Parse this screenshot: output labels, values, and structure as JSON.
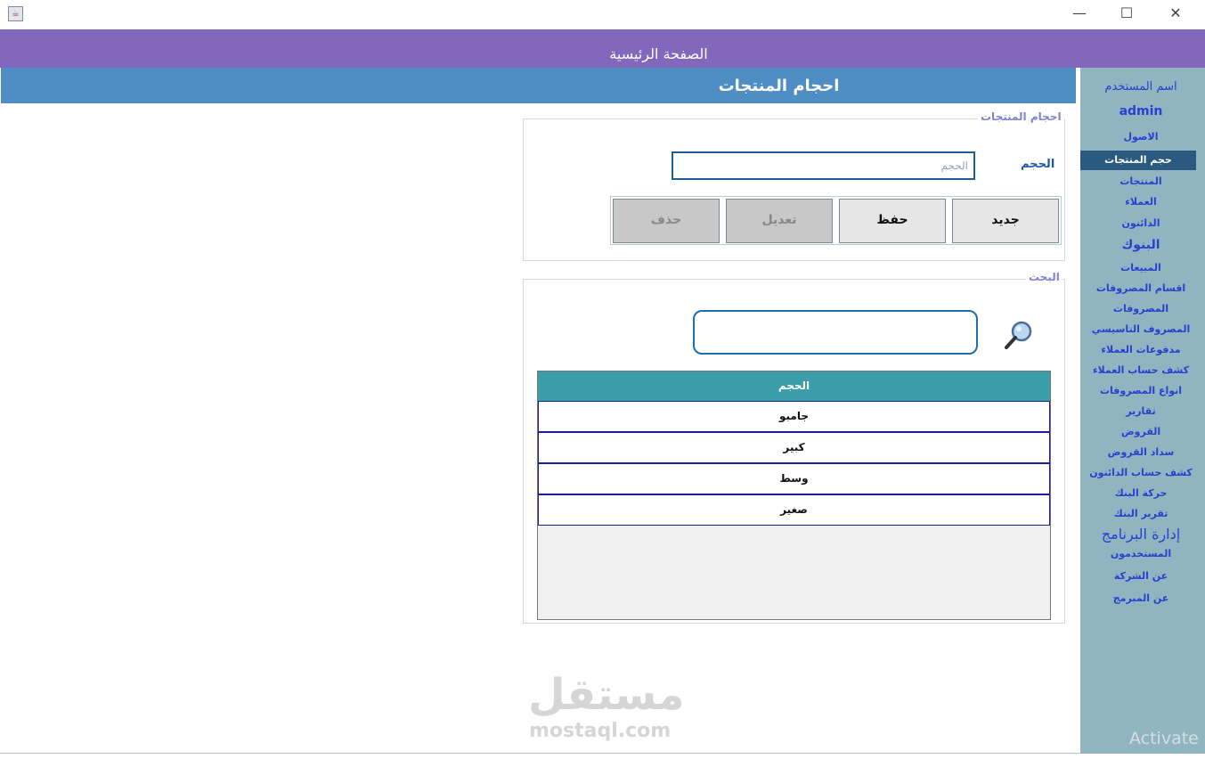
{
  "window": {
    "minimize": "—",
    "maximize": "☐",
    "close": "✕",
    "icon": "java-cup-icon"
  },
  "topbar": {
    "title": "الصفحة الرئيسية"
  },
  "header": {
    "title": "احجام المنتجات"
  },
  "sidebar": {
    "user_label": "اسم المستخدم",
    "username": "admin",
    "items": [
      {
        "label": "الاصول"
      },
      {
        "label": "حجم المنتجات",
        "active": true
      },
      {
        "label": "المنتجات"
      },
      {
        "label": "العملاء"
      },
      {
        "label": "الدائنون"
      },
      {
        "label": "البنوك"
      },
      {
        "label": "المبيعات"
      },
      {
        "label": "اقسام المصروفات"
      },
      {
        "label": "المصروفات"
      },
      {
        "label": "المصروف التاسيسي"
      },
      {
        "label": "مدفوعات العملاء"
      },
      {
        "label": "كشف حساب العملاء"
      },
      {
        "label": "انواع المصروفات"
      },
      {
        "label": "تقارير"
      },
      {
        "label": "القروض"
      },
      {
        "label": "سداد القروض"
      },
      {
        "label": "كشف حساب الدائنون"
      },
      {
        "label": "حركة البنك"
      },
      {
        "label": "تقرير البنك"
      },
      {
        "label": "إدارة البرنامج"
      },
      {
        "label": "المستخدمون"
      },
      {
        "label": "عن الشركة"
      },
      {
        "label": "عن المبرمج"
      }
    ]
  },
  "form": {
    "legend": "احجام المنتجات",
    "volume_label": "الحجم",
    "volume_placeholder": "الحجم",
    "buttons": {
      "new": "جديد",
      "save": "حفظ",
      "edit": "تعديل",
      "delete": "حذف"
    }
  },
  "search": {
    "legend": "البحث",
    "table": {
      "header": "الحجم",
      "rows": [
        "جامبو",
        "كبير",
        "وسط",
        "صغير"
      ]
    }
  },
  "watermark": {
    "arabic": "مستقل",
    "latin": "mostaql.com"
  },
  "activate_text": "Activate",
  "colors": {
    "topbar": "#8268bd",
    "header": "#4f8ec4",
    "sidebar": "#8fb5c0",
    "active": "#2b5a80",
    "table_header": "#3a9fa8"
  }
}
